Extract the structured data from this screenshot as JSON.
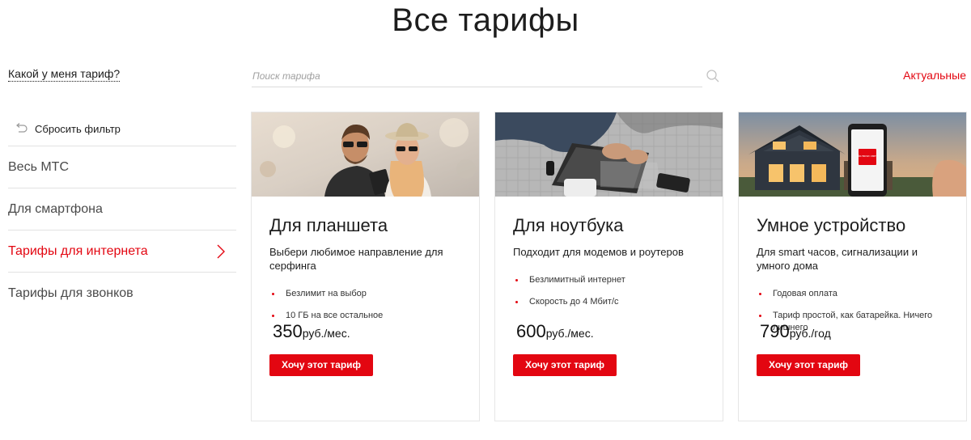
{
  "page": {
    "title": "Все тарифы"
  },
  "left_link": "Какой у меня тариф?",
  "search": {
    "placeholder": "Поиск тарифа",
    "value": ""
  },
  "sort_link": "Актуальные",
  "sidebar": {
    "reset_label": "Сбросить фильтр",
    "items": [
      {
        "label": "Весь МТС",
        "active": false
      },
      {
        "label": "Для смартфона",
        "active": false
      },
      {
        "label": "Тарифы для интернета",
        "active": true
      },
      {
        "label": "Тарифы для звонков",
        "active": false
      }
    ]
  },
  "cards": [
    {
      "title": "Для планшета",
      "description": "Выбери любимое направление для серфинга",
      "features": [
        "Безлимит на выбор",
        "10 ГБ на все остальное"
      ],
      "price": "350",
      "unit": "руб./мес.",
      "button": "Хочу этот тариф"
    },
    {
      "title": "Для ноутбука",
      "description": "Подходит для модемов и роутеров",
      "features": [
        "Безлимитный интернет",
        "Скорость до 4 Мбит/с"
      ],
      "price": "600",
      "unit": "руб./мес.",
      "button": "Хочу этот тариф"
    },
    {
      "title": "Умное устройство",
      "description": "Для smart часов, сигнализации и умного дома",
      "features": [
        "Годовая оплата",
        "Тариф простой, как батарейка. Ничего лишнего"
      ],
      "price": "790",
      "unit": "руб./год",
      "button": "Хочу этот тариф"
    }
  ],
  "card_3_phone_button": "Включи свет",
  "colors": {
    "accent": "#e30611",
    "text": "#1d1d1d",
    "border": "#e2e2e2"
  }
}
